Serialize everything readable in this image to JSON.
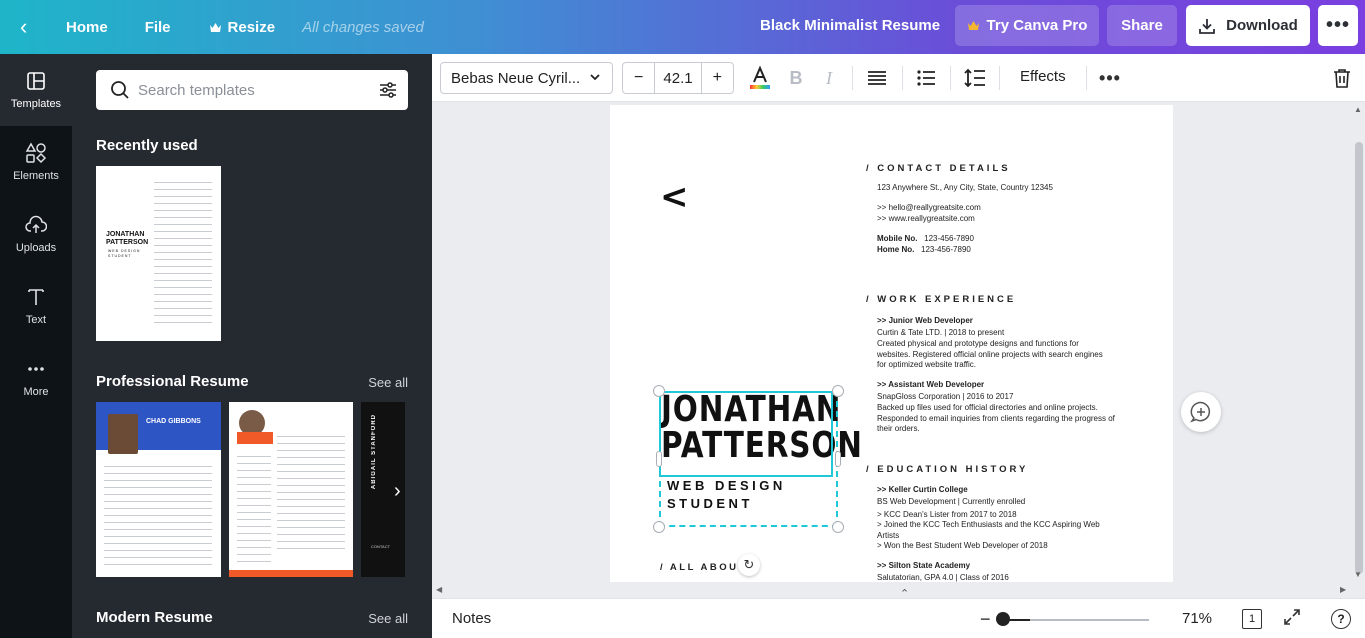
{
  "topbar": {
    "home": "Home",
    "file": "File",
    "resize": "Resize",
    "saved_status": "All changes saved",
    "doc_title": "Black Minimalist Resume",
    "try_pro": "Try Canva Pro",
    "share": "Share",
    "download": "Download"
  },
  "rail": {
    "items": [
      {
        "label": "Templates",
        "icon": "templates-icon"
      },
      {
        "label": "Elements",
        "icon": "elements-icon"
      },
      {
        "label": "Uploads",
        "icon": "upload-icon"
      },
      {
        "label": "Text",
        "icon": "text-icon"
      },
      {
        "label": "More",
        "icon": "more-icon"
      }
    ]
  },
  "panel": {
    "search_placeholder": "Search templates",
    "sections": [
      {
        "title": "Recently used"
      },
      {
        "title": "Professional Resume",
        "see_all": "See all"
      },
      {
        "title": "Modern Resume",
        "see_all": "See all"
      }
    ],
    "thumbs": {
      "recent_name": "JONATHAN PATTERSON",
      "recent_sub": "WEB DESIGN STUDENT",
      "pro1_name": "CHAD GIBBONS",
      "pro3_name": "ABIGAIL STANFORD",
      "pro3_footer": "CONTACT"
    }
  },
  "toolbar": {
    "font": "Bebas Neue Cyril...",
    "font_size": "42.1",
    "effects": "Effects"
  },
  "resume": {
    "contact_heading": "/ CONTACT DETAILS",
    "address": "123 Anywhere St., Any City, State, Country 12345",
    "email": ">>  hello@reallygreatsite.com",
    "website": ">>  www.reallygreatsite.com",
    "mobile_label": "Mobile No.",
    "mobile": "123-456-7890",
    "home_label": "Home No.",
    "home": "123-456-7890",
    "work_heading": "/ WORK EXPERIENCE",
    "job1_title": ">> Junior Web Developer",
    "job1_company": "Curtin & Tate LTD. | 2018 to present",
    "job1_desc": "Created physical and prototype designs and functions for websites. Registered official online projects with search engines for optimized website traffic.",
    "job2_title": ">> Assistant Web Developer",
    "job2_company": "SnapGloss Corporation | 2016 to 2017",
    "job2_desc": "Backed up files used for official directories and online projects. Responded to email inquiries from clients regarding the progress of their orders.",
    "edu_heading": "/ EDUCATION HISTORY",
    "edu1_school": ">> Keller Curtin College",
    "edu1_degree": "BS Web Development | Currently enrolled",
    "edu1_items": [
      ">  KCC Dean's Lister from 2017 to 2018",
      ">  Joined the KCC Tech Enthusiasts and the KCC Aspiring Web Artists",
      ">  Won the Best Student Web Developer of 2018"
    ],
    "edu2_school": ">> Silton State Academy",
    "edu2_degree": "Salutatorian, GPA 4.0 | Class of 2016",
    "name_line1": "JONATHAN",
    "name_line2": "PATTERSON",
    "subtitle_line1": "WEB DESIGN",
    "subtitle_line2": "STUDENT",
    "about_heading": "/ ALL ABOUT",
    "chevron": "<"
  },
  "bottombar": {
    "notes": "Notes",
    "zoom": "71%",
    "page_count": "1"
  }
}
